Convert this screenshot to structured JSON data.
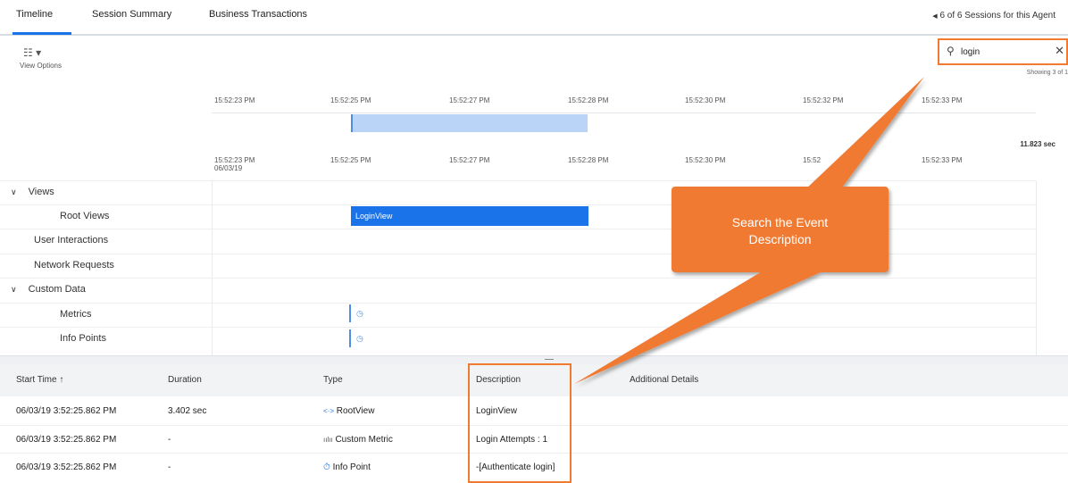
{
  "tabs": [
    {
      "label": "Timeline",
      "active": true
    },
    {
      "label": "Session Summary",
      "active": false
    },
    {
      "label": "Business Transactions",
      "active": false
    }
  ],
  "sessions_nav": {
    "arrow": "◀",
    "label": "6 of 6 Sessions for this Agent"
  },
  "toolbar": {
    "view_options_label": "View Options",
    "view_options_icon": "settings-icon"
  },
  "search": {
    "value": "login",
    "placeholder": "",
    "clear": "✕",
    "showing": "Showing 3 of 1"
  },
  "timeline": {
    "overview_ticks": [
      "15:52:23 PM",
      "15:52:25 PM",
      "15:52:27 PM",
      "15:52:28 PM",
      "15:52:30 PM",
      "15:52:32 PM",
      "15:52:33 PM"
    ],
    "detail_ticks": [
      "15:52:23 PM",
      "15:52:25 PM",
      "15:52:27 PM",
      "15:52:28 PM",
      "15:52:30 PM",
      "15:52",
      "15:52:33 PM"
    ],
    "first_date": "06/03/19",
    "duration": "11.823 sec"
  },
  "rows": [
    {
      "label": "Views",
      "expandable": true
    },
    {
      "label": "Root Views",
      "expandable": false
    },
    {
      "label": "User Interactions",
      "expandable": false
    },
    {
      "label": "Network Requests",
      "expandable": false
    },
    {
      "label": "Custom Data",
      "expandable": true
    },
    {
      "label": "Metrics",
      "expandable": false
    },
    {
      "label": "Info Points",
      "expandable": false
    }
  ],
  "bars": {
    "login_view": "LoginView"
  },
  "table": {
    "headers": [
      "Start Time ↑",
      "Duration",
      "Type",
      "Description",
      "Additional Details"
    ],
    "rows": [
      {
        "start": "06/03/19 3:52:25.862 PM",
        "duration": "3.402 sec",
        "type_icon": "<·>",
        "type": "RootView",
        "description": "LoginView"
      },
      {
        "start": "06/03/19 3:52:25.862 PM",
        "duration": "-",
        "type_icon": "ıılıı",
        "type": "Custom Metric",
        "description": "Login Attempts : 1"
      },
      {
        "start": "06/03/19 3:52:25.862 PM",
        "duration": "-",
        "type_icon": "⏱",
        "type": "Info Point",
        "description": "-[Authenticate login]"
      }
    ]
  },
  "callout": {
    "line1": "Search the Event",
    "line2": "Description"
  },
  "colors": {
    "accent": "#1a73e8",
    "callout": "#f07a30",
    "selection": "#b9d4f7"
  }
}
